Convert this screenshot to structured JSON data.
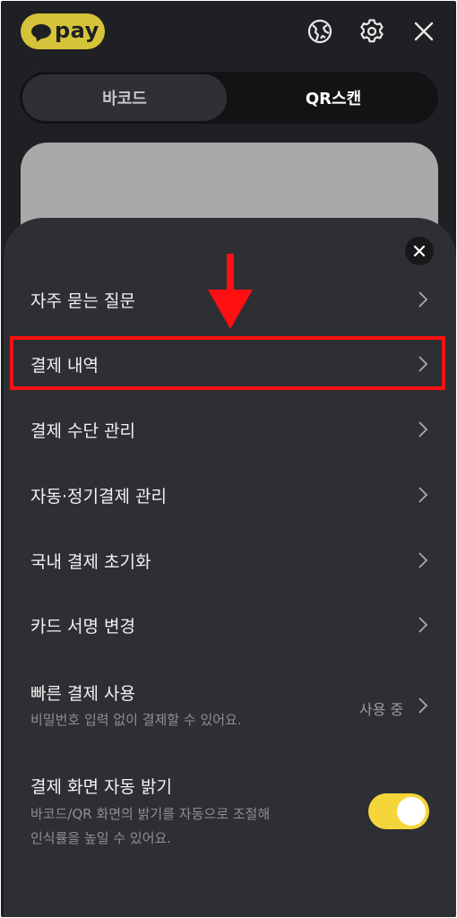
{
  "header": {
    "logo_text": "pay",
    "icons": [
      "globe-icon",
      "gear-icon",
      "close-icon"
    ]
  },
  "tabs": {
    "barcode_label": "바코드",
    "qr_label": "QR스캔",
    "active": "바코드"
  },
  "menu": {
    "items": [
      {
        "label": "자주 묻는 질문"
      },
      {
        "label": "결제 내역"
      },
      {
        "label": "결제 수단 관리"
      },
      {
        "label": "자동·정기결제 관리"
      },
      {
        "label": "국내 결제 초기화"
      },
      {
        "label": "카드 서명 변경"
      },
      {
        "label": "빠른 결제 사용",
        "description": "비밀번호 입력 없이 결제할 수 있어요.",
        "value": "사용 중"
      },
      {
        "label": "결제 화면 자동 밝기",
        "description_line1": "바코드/QR 화면의 밝기를 자동으로 조절해",
        "description_line2": "인식률을 높일 수 있어요.",
        "toggle_on": true
      }
    ]
  },
  "colors": {
    "background": "#1f2023",
    "sheet": "#2d2f33",
    "accent_yellow": "#f5d63a",
    "logo_yellow": "#d5c33a",
    "highlight_red": "#ff0f12"
  }
}
